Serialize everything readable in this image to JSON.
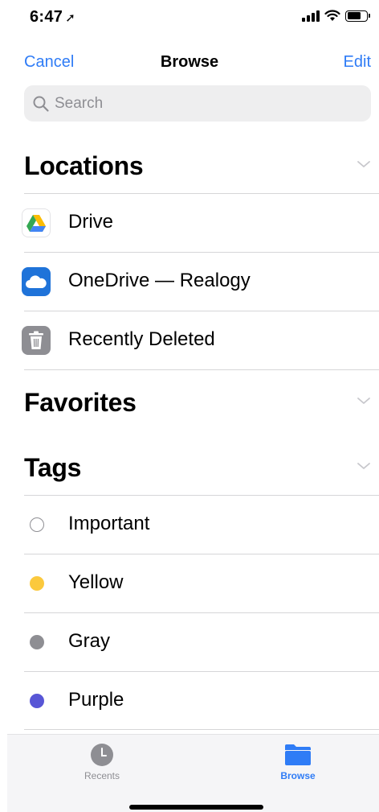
{
  "status_bar": {
    "time": "6:47",
    "location_arrow": "location-arrow-icon"
  },
  "nav": {
    "left": "Cancel",
    "title": "Browse",
    "right": "Edit"
  },
  "search": {
    "placeholder": "Search"
  },
  "sections": {
    "locations": {
      "title": "Locations"
    },
    "favorites": {
      "title": "Favorites"
    },
    "tags": {
      "title": "Tags"
    }
  },
  "locations": [
    {
      "label": "Drive",
      "icon": "google-drive-icon"
    },
    {
      "label": "OneDrive — Realogy",
      "icon": "onedrive-icon"
    },
    {
      "label": "Recently Deleted",
      "icon": "trash-icon"
    }
  ],
  "tags": [
    {
      "label": "Important",
      "color": "#ffffff"
    },
    {
      "label": "Yellow",
      "color": "#fbc93d"
    },
    {
      "label": "Gray",
      "color": "#8e8e93"
    },
    {
      "label": "Purple",
      "color": "#5856d6"
    }
  ],
  "tabbar": {
    "recents": "Recents",
    "browse": "Browse"
  },
  "colors": {
    "accent": "#2f7cf6",
    "separator": "#d6d6d8"
  }
}
